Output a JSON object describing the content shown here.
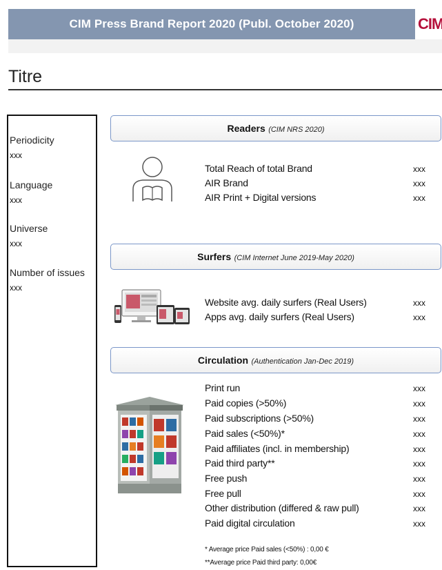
{
  "header": {
    "title": "CIM Press Brand Report 2020 (Publ. October 2020)",
    "logo_text": "CIM",
    "bar_color": "#8496b0",
    "logo_color": "#b5103b"
  },
  "page_title": "Titre",
  "sidebar": {
    "fields": [
      {
        "label": "Periodicity",
        "value": "xxx"
      },
      {
        "label": "Language",
        "value": "xxx"
      },
      {
        "label": "Universe",
        "value": "xxx"
      },
      {
        "label": "Number of issues",
        "value": "xxx"
      }
    ]
  },
  "readers": {
    "title": "Readers",
    "subtitle": "(CIM NRS 2020)",
    "icon": "reader-icon",
    "rows": [
      {
        "label": "Total Reach of total Brand",
        "value": "xxx"
      },
      {
        "label": "AIR Brand",
        "value": "xxx"
      },
      {
        "label": "AIR Print + Digital versions",
        "value": "xxx"
      }
    ]
  },
  "surfers": {
    "title": "Surfers",
    "subtitle": "(CIM Internet June 2019-May 2020)",
    "icon": "devices-icon",
    "rows": [
      {
        "label": "Website avg. daily surfers (Real Users)",
        "value": "xxx"
      },
      {
        "label": "Apps avg. daily surfers (Real Users)",
        "value": "xxx"
      }
    ]
  },
  "circulation": {
    "title": "Circulation",
    "subtitle": "(Authentication Jan-Dec 2019)",
    "icon": "newsstand-icon",
    "rows": [
      {
        "label": "Print run",
        "value": "xxx"
      },
      {
        "label": "Paid copies (>50%)",
        "value": "xxx"
      },
      {
        "label": "Paid subscriptions (>50%)",
        "value": "xxx"
      },
      {
        "label": "Paid sales (<50%)*",
        "value": "xxx"
      },
      {
        "label": "Paid affiliates (incl. in membership)",
        "value": "xxx"
      },
      {
        "label": "Paid third party**",
        "value": "xxx"
      },
      {
        "label": "Free push",
        "value": "xxx"
      },
      {
        "label": "Free pull",
        "value": "xxx"
      },
      {
        "label": "Other distribution (differed & raw pull)",
        "value": "xxx"
      },
      {
        "label": "Paid digital circulation",
        "value": "xxx"
      }
    ],
    "footnotes": [
      "* Average price Paid sales (<50%) : 0,00 €",
      "**Average price Paid third party: 0,00€"
    ]
  }
}
